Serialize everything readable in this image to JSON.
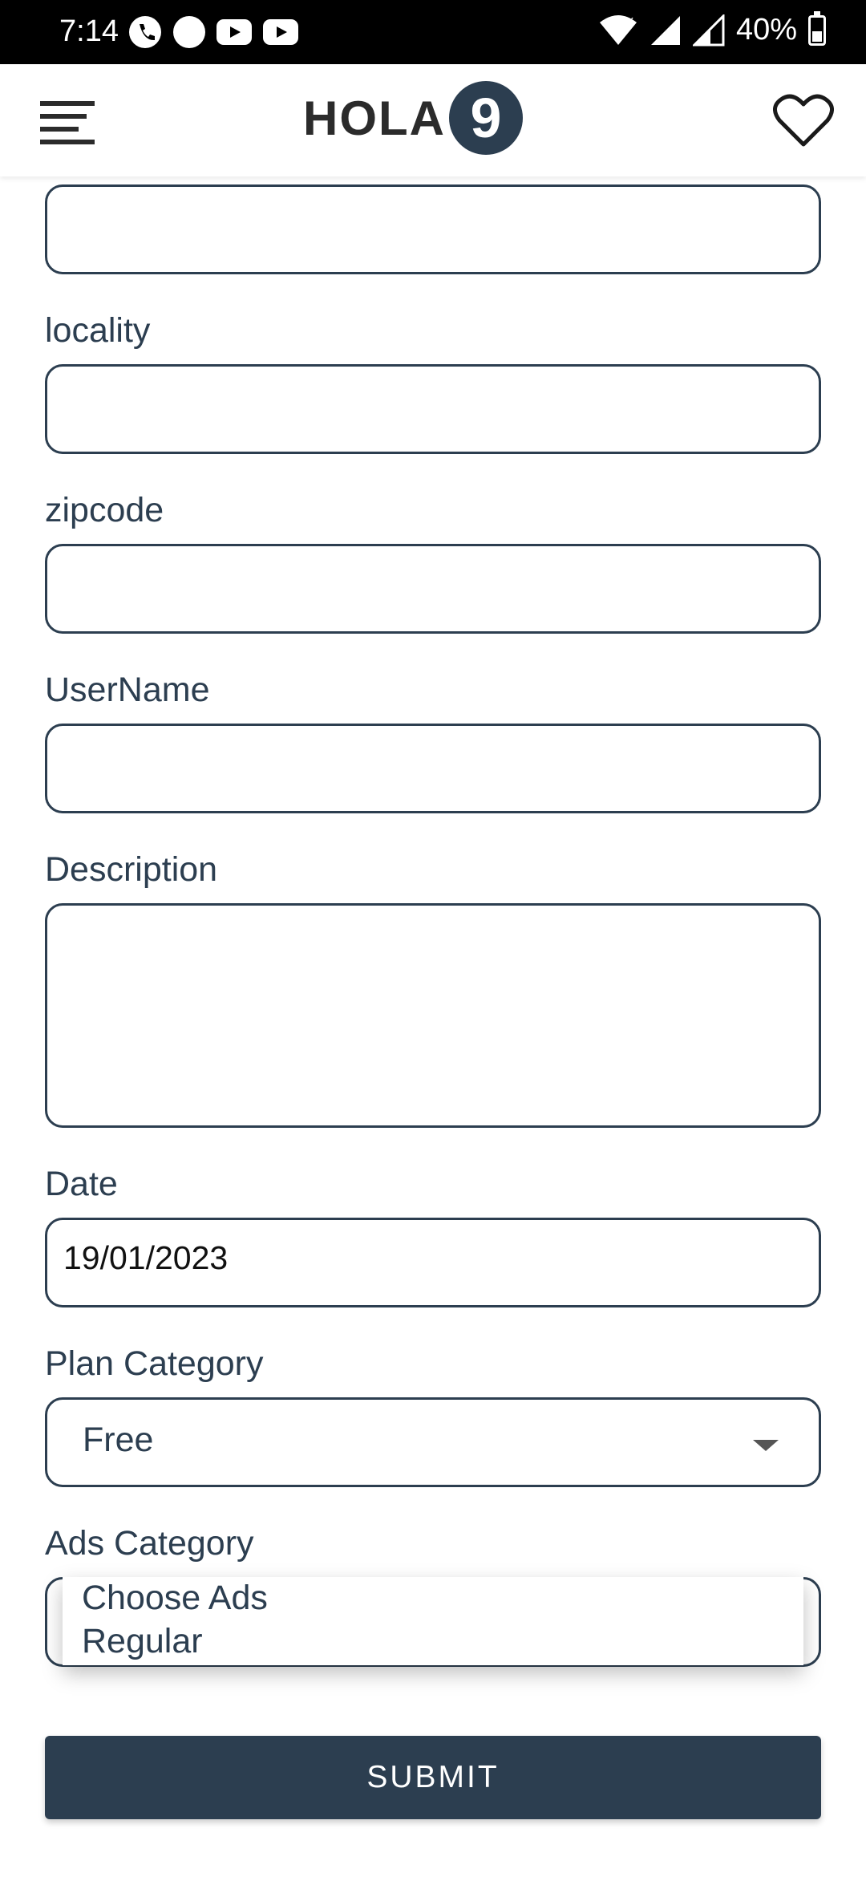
{
  "status_bar": {
    "time": "7:14",
    "battery": "40%",
    "icons": [
      "phone-icon",
      "circle-notification-icon",
      "youtube-icon",
      "youtube-icon",
      "wifi-icon",
      "signal-icon",
      "signal-icon",
      "battery-icon"
    ]
  },
  "header": {
    "logo_text": "HOLA",
    "logo_badge": "9",
    "menu_icon": "hamburger-menu-icon",
    "favorite_icon": "heart-icon"
  },
  "form": {
    "top_field_value": "",
    "locality": {
      "label": "locality",
      "value": ""
    },
    "zipcode": {
      "label": "zipcode",
      "value": ""
    },
    "username": {
      "label": "UserName",
      "value": ""
    },
    "description": {
      "label": "Description",
      "value": ""
    },
    "date": {
      "label": "Date",
      "value": "19/01/2023"
    },
    "plan_category": {
      "label": "Plan Category",
      "selected": "Free"
    },
    "ads_category": {
      "label": "Ads Category",
      "options": [
        "Choose Ads",
        "Regular"
      ]
    },
    "submit_label": "SUBMIT"
  },
  "colors": {
    "primary": "#2c3e50",
    "status_bar": "#000000",
    "background": "#ffffff"
  }
}
